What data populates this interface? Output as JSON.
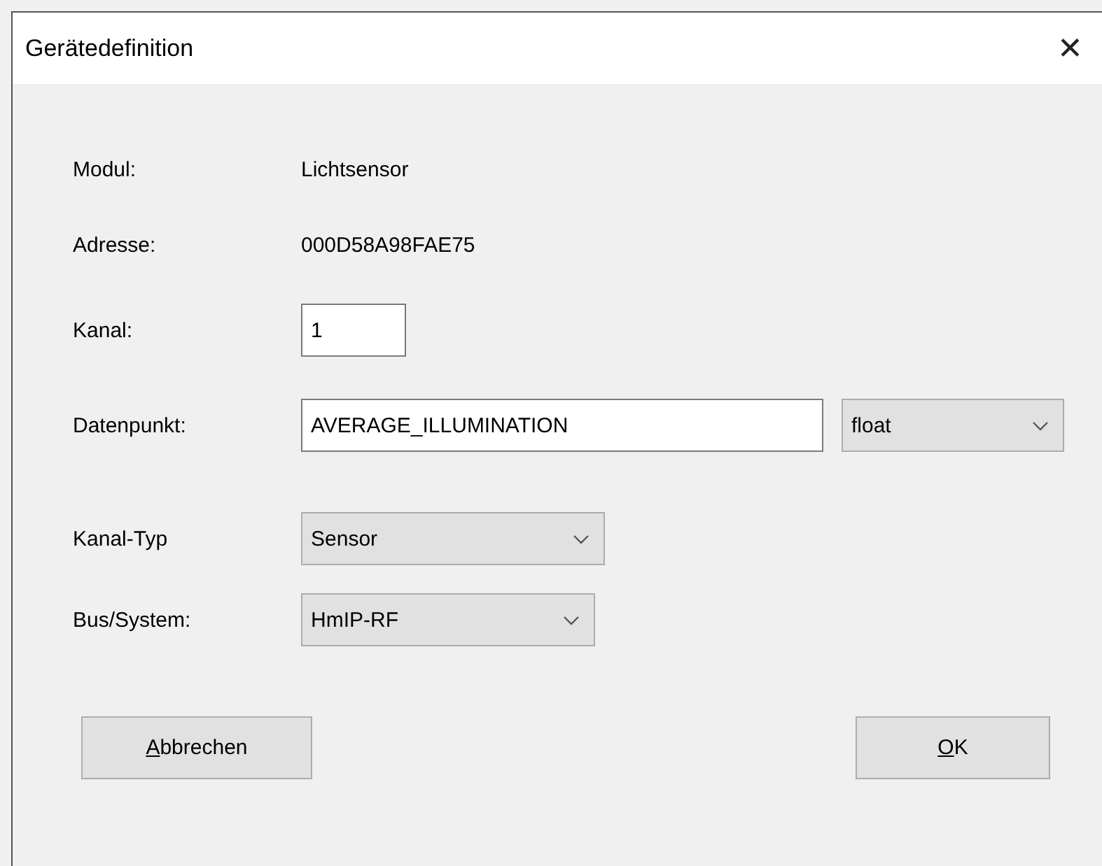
{
  "window": {
    "title": "Gerätedefinition",
    "close": "✕"
  },
  "info_rows": [
    {
      "label": "Modul:",
      "value": "Lichtsensor"
    },
    {
      "label": "Adresse:",
      "value": "000D58A98FAE75"
    }
  ],
  "channel": {
    "label": "Kanal:",
    "value": "1"
  },
  "datapoint": {
    "label": "Datenpunkt:",
    "value": "AVERAGE_ILLUMINATION",
    "type": "float"
  },
  "dropdowns": [
    {
      "label": "Kanal-Typ",
      "value": "Sensor"
    },
    {
      "label": "Bus/System:",
      "value": "HmIP-RF"
    }
  ],
  "buttons": [
    {
      "mnemonic": "A",
      "label_rest": "bbrechen"
    },
    {
      "mnemonic": "O",
      "label_rest": "K"
    }
  ]
}
